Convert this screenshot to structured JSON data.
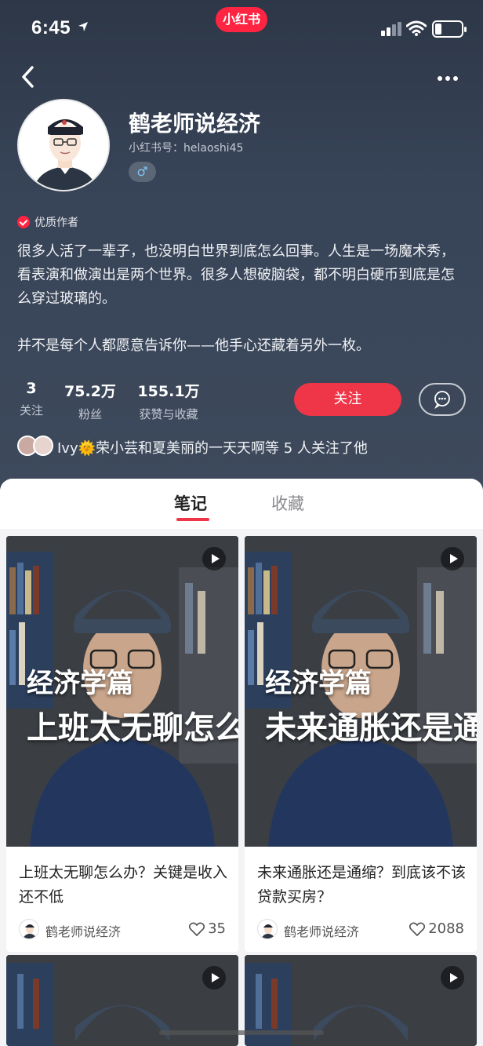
{
  "status_bar": {
    "time": "6:45",
    "app_label": "小红书"
  },
  "profile": {
    "name": "鹤老师说经济",
    "red_id": "小红书号：helaoshi45",
    "gender_symbol": "♂",
    "quality_label": "优质作者",
    "bio_paragraphs": [
      "很多人活了一辈子，也没明白世界到底怎么回事。人生是一场魔术秀，看表演和做演出是两个世界。很多人想破脑袋，都不明白硬币到底是怎么穿过玻璃的。",
      "并不是每个人都愿意告诉你——他手心还藏着另外一枚。"
    ],
    "stats": [
      {
        "value": "3",
        "label": "关注"
      },
      {
        "value": "75.2万",
        "label": "粉丝"
      },
      {
        "value": "155.1万",
        "label": "获赞与收藏"
      }
    ],
    "follow_label": "关注",
    "followed_by_text": "Ivy🌞荣小芸和夏美丽的一天天啊等 5 人关注了他"
  },
  "tabs": [
    {
      "label": "笔记",
      "active": true
    },
    {
      "label": "收藏",
      "active": false
    }
  ],
  "notes": [
    {
      "overlay_sub": "经济学篇",
      "overlay_main": "上班太无聊怎么办",
      "title": "上班太无聊怎么办？关键是收入还不低",
      "author": "鹤老师说经济",
      "likes": "35"
    },
    {
      "overlay_sub": "经济学篇",
      "overlay_main": "未来通胀还是通缩",
      "title": "未来通胀还是通缩？到底该不该贷款买房？",
      "author": "鹤老师说经济",
      "likes": "2088"
    }
  ],
  "colors": {
    "accent": "#ef3548",
    "header_bg": "#374357"
  }
}
